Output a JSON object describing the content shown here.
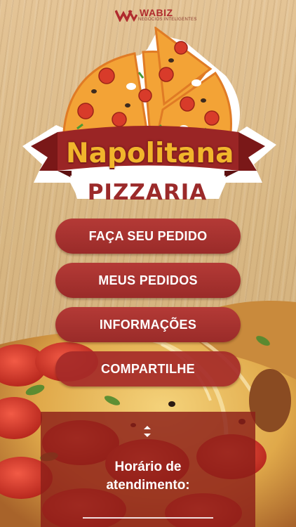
{
  "brand": {
    "name": "WABIZ",
    "tagline": "NEGÓCIOS INTELIGENTES",
    "color": "#b02b2e"
  },
  "logo": {
    "name": "Napolitana",
    "subtitle": "PIZZARIA",
    "ribbon_color": "#8e2222",
    "name_color": "#f1b62c"
  },
  "menu": {
    "items": [
      {
        "label": "FAÇA SEU PEDIDO"
      },
      {
        "label": "MEUS PEDIDOS"
      },
      {
        "label": "INFORMAÇÕES"
      },
      {
        "label": "COMPARTILHE"
      }
    ],
    "button_color": "#a8302d"
  },
  "hours": {
    "title": "Horário de atendimento:",
    "toggle_icon": "expand-collapse-chevrons-icon"
  }
}
